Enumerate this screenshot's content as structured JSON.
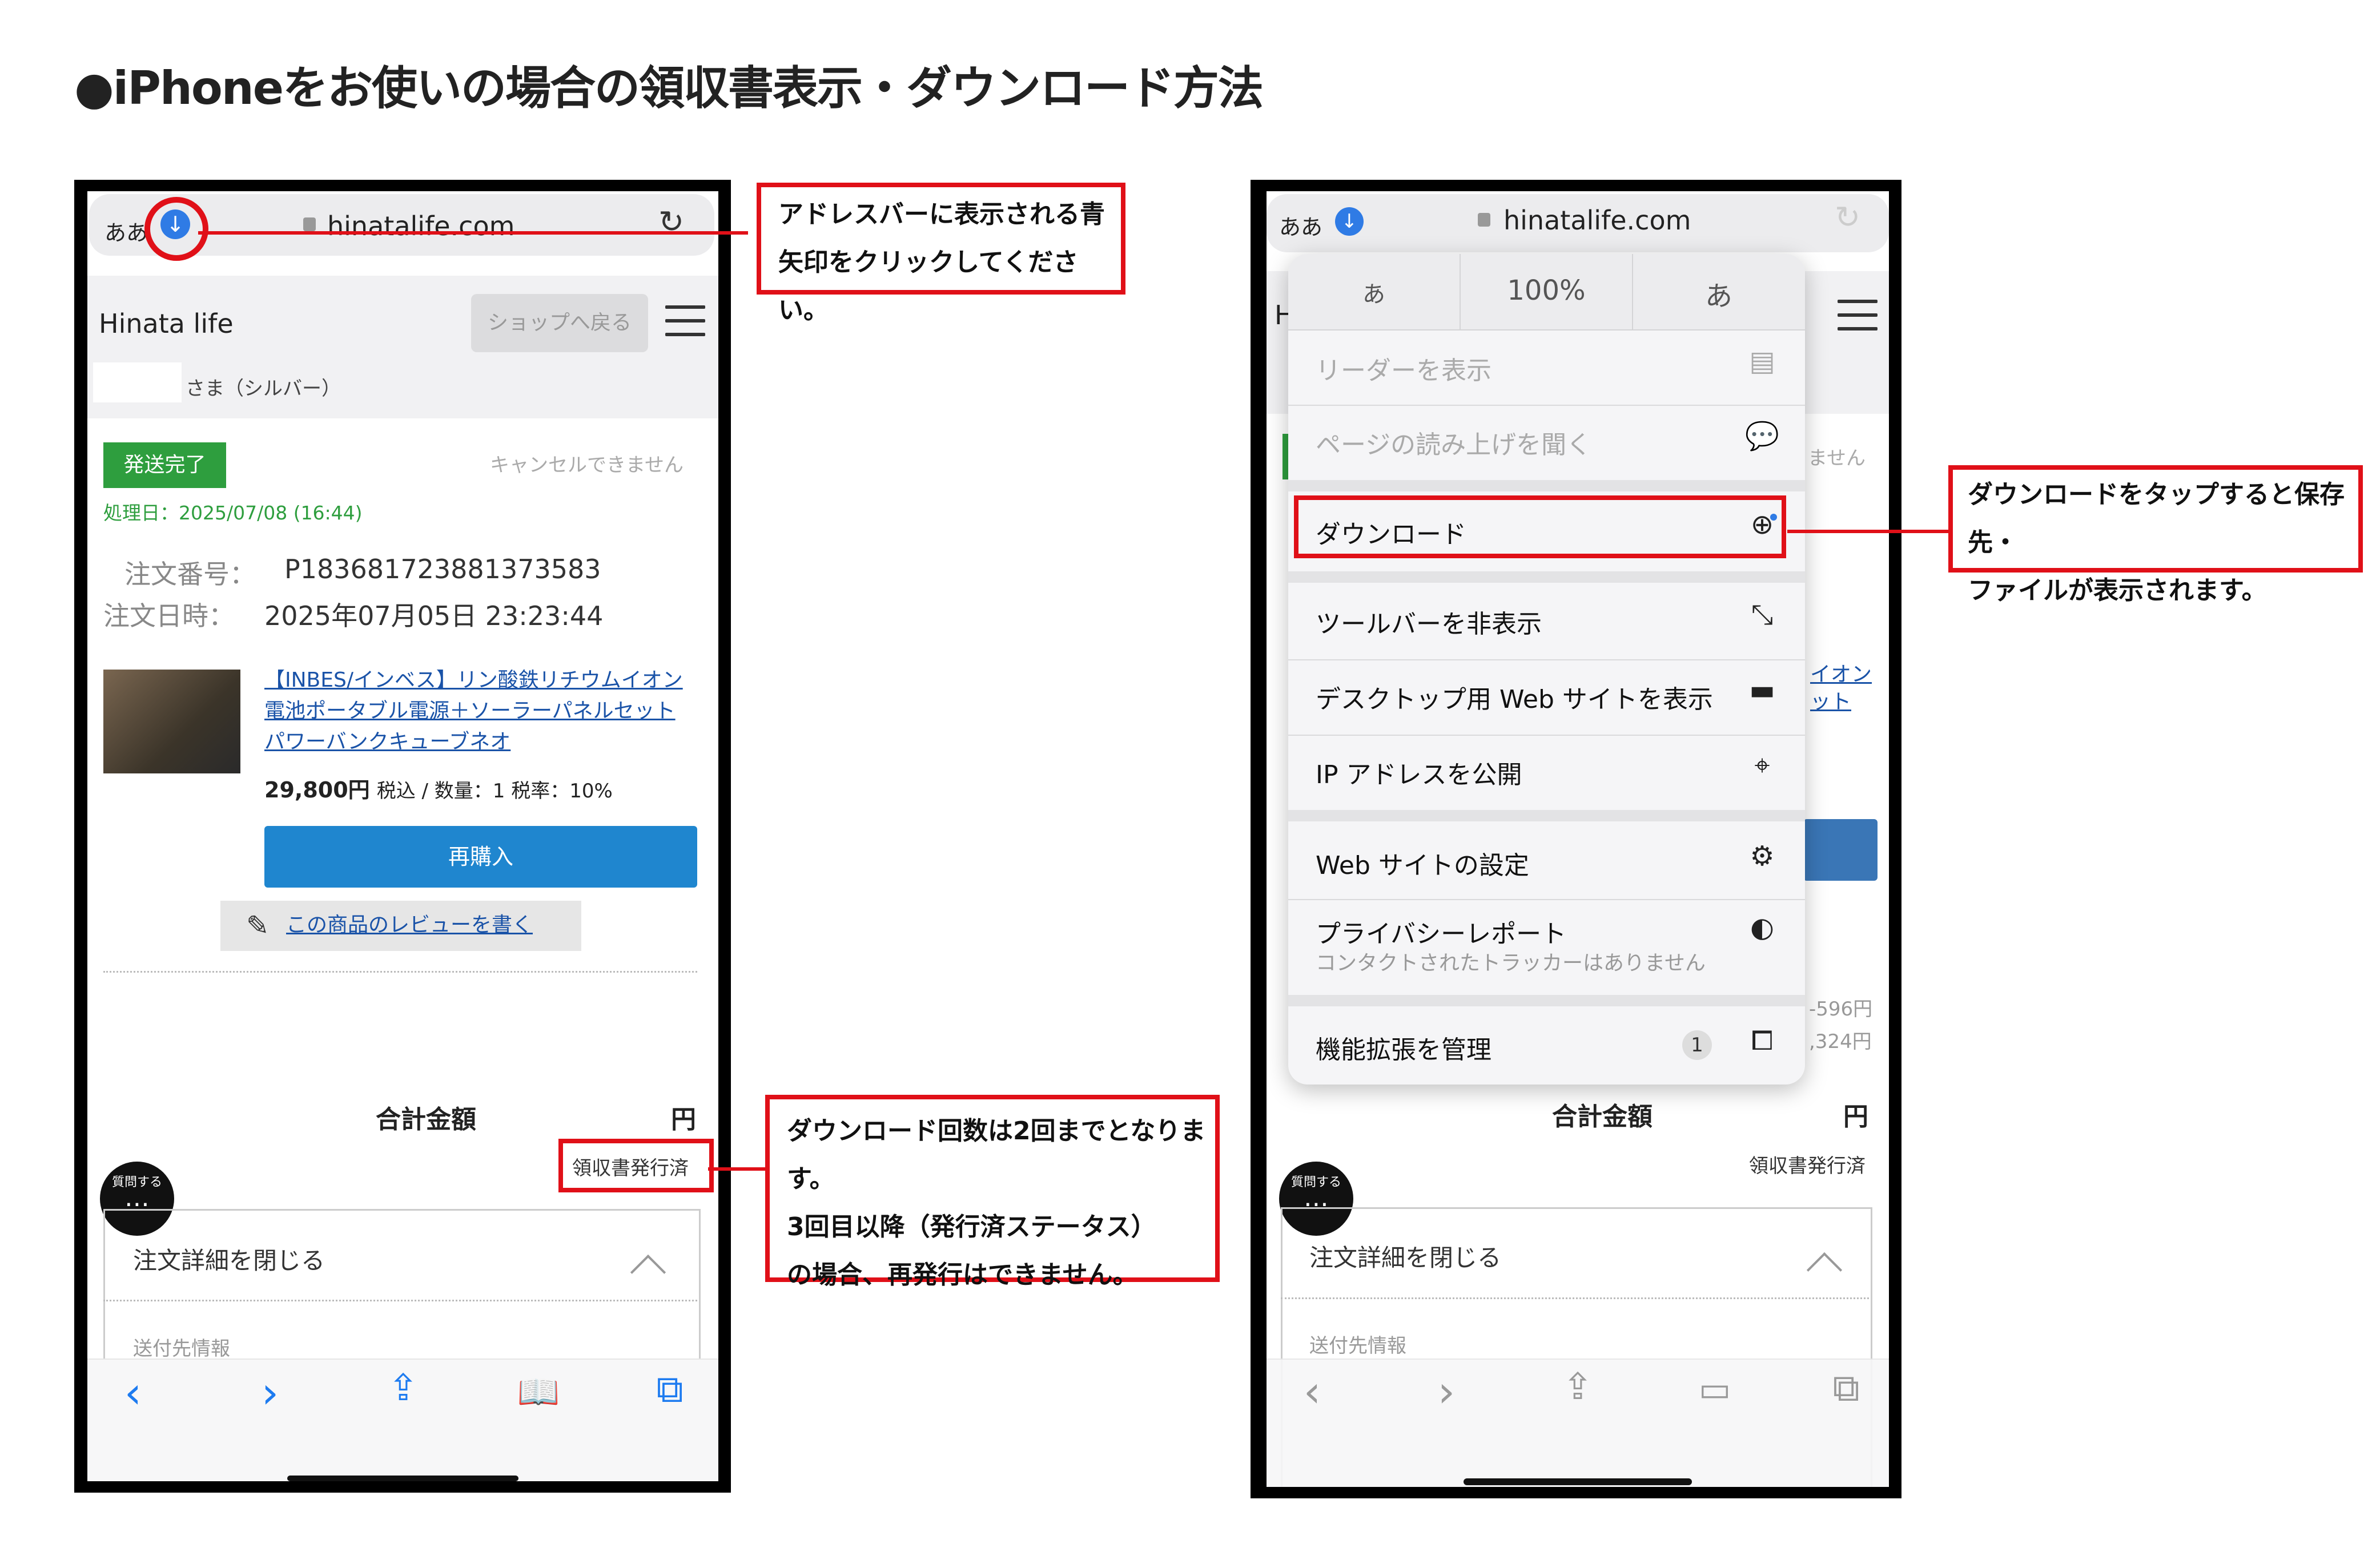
{
  "heading": "●iPhoneをお使いの場合の領収書表示・ダウンロード方法",
  "left_phone": {
    "addressbar": {
      "aa": "ああ",
      "download_arrow": "↓",
      "domain": "hinatalife.com",
      "reload_icon": "reload-icon"
    },
    "shop": {
      "brand": "Hinata life",
      "back_button": "ショップへ戻る",
      "customer_suffix": "さま（シルバー）"
    },
    "order": {
      "status": "発送完了",
      "cancel_note": "キャンセルできません",
      "processed": "処理日：2025/07/08 (16:44)",
      "number_label": "注文番号：",
      "number_value": "P183681723881373583",
      "date_label": "注文日時：",
      "date_value": "2025年07月05日 23:23:44"
    },
    "product": {
      "title_line1": "【INBES/インベス】リン酸鉄リチウムイオン",
      "title_line2": "電池ポータブル電源＋ソーラーパネルセット",
      "title_line3": "パワーバンクキューブネオ",
      "price": "29,800円",
      "meta": "税込 / 数量：1 税率：10%",
      "rebuy": "再購入",
      "review": "この商品のレビューを書く"
    },
    "total_label": "合計金額",
    "total_unit": "円",
    "receipt": "領収書発行済",
    "chat_label": "質問する",
    "details_close": "注文詳細を閉じる",
    "ship_info": "送付先情報",
    "toolbar": {
      "back": "‹",
      "forward": "›",
      "share": "⇪",
      "bookmarks": "📖",
      "tabs": "⧉"
    }
  },
  "annotations": {
    "arrow_note_line1": "アドレスバーに表示される青",
    "arrow_note_line2": "矢印をクリックしてください。",
    "count_note_line1": "ダウンロード回数は2回までとなります。",
    "count_note_line2": "3回目以降（発行済ステータス）",
    "count_note_line3": "の場合、再発行はできません。",
    "download_note_line1": "ダウンロードをタップすると保存先・",
    "download_note_line2": "ファイルが表示されます。"
  },
  "right_phone": {
    "addressbar": {
      "aa": "ああ",
      "domain": "hinatalife.com"
    },
    "menu": {
      "font_small": "あ",
      "zoom": "100%",
      "font_large": "あ",
      "items": [
        {
          "label": "リーダーを表示",
          "icon": "reader-icon"
        },
        {
          "label": "ページの読み上げを聞く",
          "icon": "speech-icon"
        },
        {
          "label": "ダウンロード",
          "icon": "download-icon"
        },
        {
          "label": "ツールバーを非表示",
          "icon": "resize-icon"
        },
        {
          "label": "デスクトップ用 Web サイトを表示",
          "icon": "desktop-icon"
        },
        {
          "label": "IP アドレスを公開",
          "icon": "location-icon"
        },
        {
          "label": "Web サイトの設定",
          "icon": "gear-icon"
        },
        {
          "label": "プライバシーレポート",
          "sub": "コンタクトされたトラッカーはありません",
          "icon": "shield-icon"
        },
        {
          "label": "機能拡張を管理",
          "badge": "1",
          "icon": "extension-icon"
        }
      ]
    },
    "behind": {
      "h": "H",
      "cancel_fragment": "ません",
      "link_fragment1": "イオン",
      "link_fragment2": "ット",
      "amount1": "-596円",
      "amount2": ",324円",
      "total_label": "合計金額",
      "total_unit": "円",
      "receipt": "領収書発行済",
      "chat_label": "質問する",
      "details_close": "注文詳細を閉じる",
      "ship_info": "送付先情報"
    }
  },
  "colors": {
    "annotation_red": "#e01018",
    "safari_blue": "#2f7be5",
    "status_green": "#2e9e3e",
    "rebuy_blue": "#1f86cf"
  }
}
